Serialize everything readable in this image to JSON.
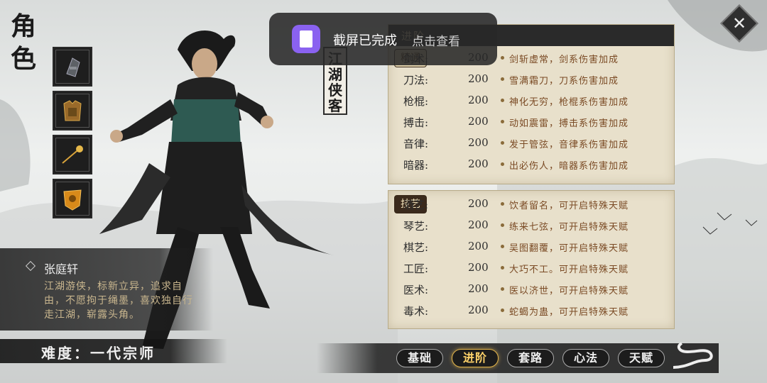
{
  "title": "角色",
  "equipment": [
    {
      "name": "gauntlet"
    },
    {
      "name": "armor"
    },
    {
      "name": "hairpin"
    },
    {
      "name": "talisman"
    }
  ],
  "character": {
    "plaque": "江湖侠客",
    "name": "张庭轩",
    "description": "江湖游侠，标新立异，追求自由，不愿拘于绳墨，喜欢独自行走江湖，崭露头角。",
    "difficulty": "难度：一代宗师"
  },
  "advanced_panel": {
    "header": "进阶",
    "tag": "精通",
    "rows": [
      {
        "skill": "剑术:",
        "value": "200",
        "effect": "剑斩虚常，剑系伤害加成"
      },
      {
        "skill": "刀法:",
        "value": "200",
        "effect": "雪满霜刀，刀系伤害加成"
      },
      {
        "skill": "枪棍:",
        "value": "200",
        "effect": "神化无穷，枪棍系伤害加成"
      },
      {
        "skill": "搏击:",
        "value": "200",
        "effect": "动如震雷，搏击系伤害加成"
      },
      {
        "skill": "音律:",
        "value": "200",
        "effect": "发于管弦，音律系伤害加成"
      },
      {
        "skill": "暗器:",
        "value": "200",
        "effect": "出必伤人，暗器系伤害加成"
      }
    ]
  },
  "craft_panel": {
    "tag": "技艺",
    "rows": [
      {
        "skill": "酒艺:",
        "value": "200",
        "effect": "饮者留名，可开启特殊天赋"
      },
      {
        "skill": "琴艺:",
        "value": "200",
        "effect": "练来七弦，可开启特殊天赋"
      },
      {
        "skill": "棋艺:",
        "value": "200",
        "effect": "吴图翻覆，可开启特殊天赋"
      },
      {
        "skill": "工匠:",
        "value": "200",
        "effect": "大巧不工。可开启特殊天赋"
      },
      {
        "skill": "医术:",
        "value": "200",
        "effect": "医以济世，可开启特殊天赋"
      },
      {
        "skill": "毒术:",
        "value": "200",
        "effect": "蛇蝎为蛊，可开启特殊天赋"
      }
    ]
  },
  "tabs": [
    {
      "label": "基础",
      "active": false
    },
    {
      "label": "进阶",
      "active": true
    },
    {
      "label": "套路",
      "active": false
    },
    {
      "label": "心法",
      "active": false
    },
    {
      "label": "天赋",
      "active": false
    }
  ],
  "toast": {
    "title": "截屏已完成",
    "action": "点击查看"
  }
}
